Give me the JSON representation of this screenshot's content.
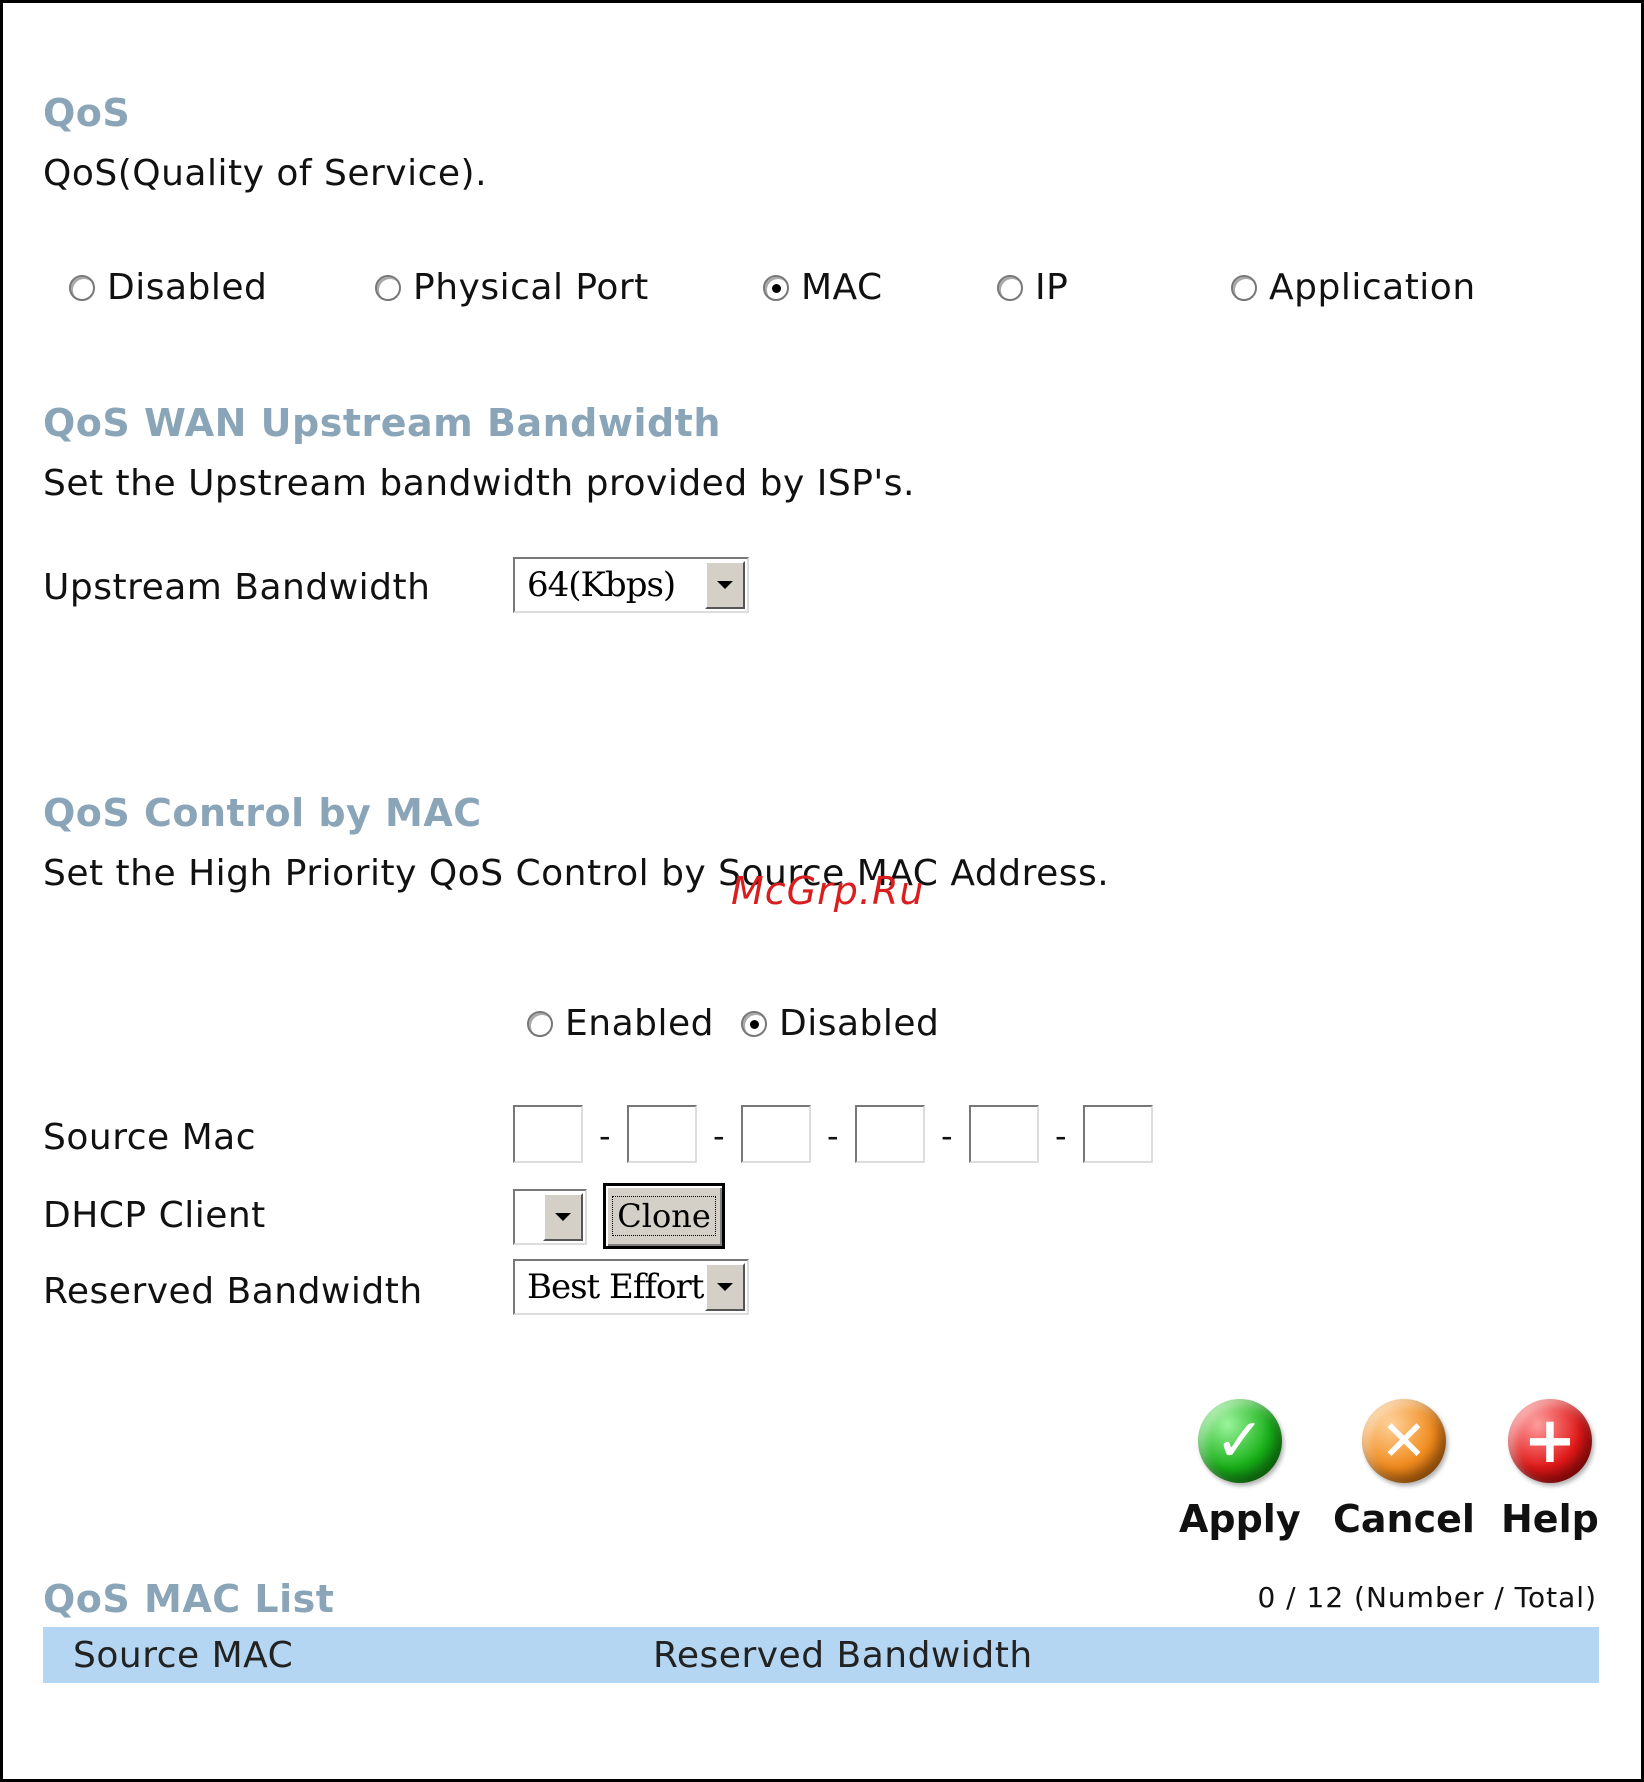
{
  "qos": {
    "title": "QoS",
    "description": "QoS(Quality of Service).",
    "modes": [
      {
        "label": "Disabled",
        "checked": false
      },
      {
        "label": "Physical Port",
        "checked": false
      },
      {
        "label": "MAC",
        "checked": true
      },
      {
        "label": "IP",
        "checked": false
      },
      {
        "label": "Application",
        "checked": false
      }
    ]
  },
  "upstream": {
    "title": "QoS WAN Upstream Bandwidth",
    "description": "Set the Upstream bandwidth provided by ISP's.",
    "field_label": "Upstream Bandwidth",
    "selected": "64(Kbps)"
  },
  "mac_control": {
    "title": "QoS Control by MAC",
    "description": "Set the High Priority QoS Control by Source MAC Address.",
    "enabled_label": "Enabled",
    "disabled_label": "Disabled",
    "enabled": false,
    "source_mac_label": "Source Mac",
    "dhcp_client_label": "DHCP Client",
    "dhcp_client_selected": "",
    "clone_label": "Clone",
    "reserved_bandwidth_label": "Reserved Bandwidth",
    "reserved_bandwidth_selected": "Best Effort"
  },
  "actions": {
    "apply": "Apply",
    "cancel": "Cancel",
    "help": "Help"
  },
  "mac_list": {
    "title": "QoS MAC List",
    "count": "0 / 12 (Number / Total)",
    "columns": [
      "Source MAC",
      "Reserved Bandwidth"
    ]
  },
  "watermark": "McGrp.Ru"
}
